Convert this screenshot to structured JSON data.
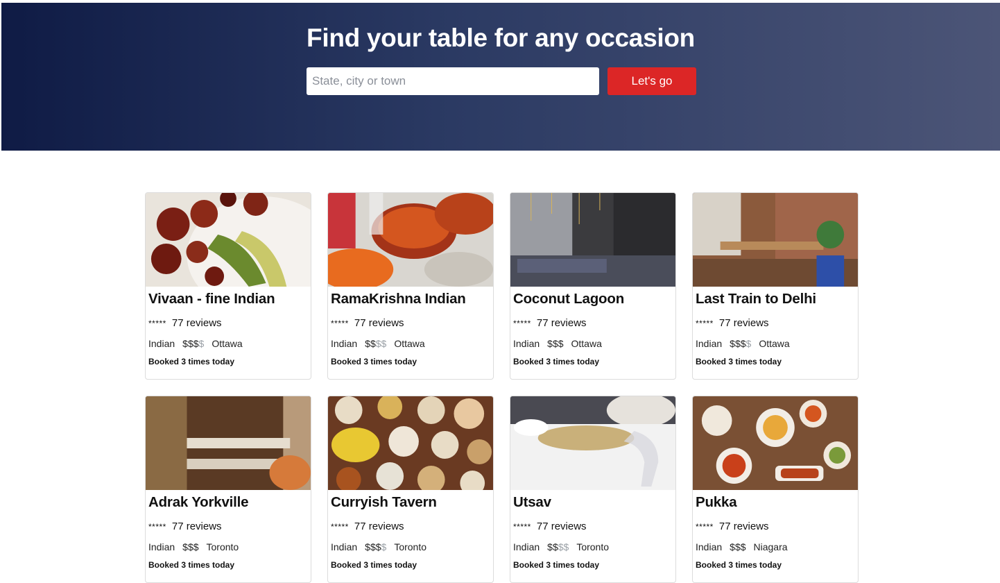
{
  "hero": {
    "title": "Find your table for any occasion",
    "search_placeholder": "State, city or town",
    "search_value": "",
    "button_label": "Let's go"
  },
  "colors": {
    "accent": "#dc2626",
    "hero_gradient_start": "#0f1b45",
    "hero_gradient_end": "#4c5577"
  },
  "restaurants": [
    {
      "name": "Vivaan - fine Indian",
      "stars": "*****",
      "reviews": "77 reviews",
      "cuisine": "Indian",
      "price_active": "$$$",
      "price_inactive": "$",
      "city": "Ottawa",
      "booked": "Booked 3 times today"
    },
    {
      "name": "RamaKrishna Indian",
      "stars": "*****",
      "reviews": "77 reviews",
      "cuisine": "Indian",
      "price_active": "$$",
      "price_inactive": "$$",
      "city": "Ottawa",
      "booked": "Booked 3 times today"
    },
    {
      "name": "Coconut Lagoon",
      "stars": "*****",
      "reviews": "77 reviews",
      "cuisine": "Indian",
      "price_active": "$$$",
      "price_inactive": "",
      "city": "Ottawa",
      "booked": "Booked 3 times today"
    },
    {
      "name": "Last Train to Delhi",
      "stars": "*****",
      "reviews": "77 reviews",
      "cuisine": "Indian",
      "price_active": "$$$",
      "price_inactive": "$",
      "city": "Ottawa",
      "booked": "Booked 3 times today"
    },
    {
      "name": "Adrak Yorkville",
      "stars": "*****",
      "reviews": "77 reviews",
      "cuisine": "Indian",
      "price_active": "$$$",
      "price_inactive": "",
      "city": "Toronto",
      "booked": "Booked 3 times today"
    },
    {
      "name": "Curryish Tavern",
      "stars": "*****",
      "reviews": "77 reviews",
      "cuisine": "Indian",
      "price_active": "$$$",
      "price_inactive": "$",
      "city": "Toronto",
      "booked": "Booked 3 times today"
    },
    {
      "name": "Utsav",
      "stars": "*****",
      "reviews": "77 reviews",
      "cuisine": "Indian",
      "price_active": "$$",
      "price_inactive": "$$",
      "city": "Toronto",
      "booked": "Booked 3 times today"
    },
    {
      "name": "Pukka",
      "stars": "*****",
      "reviews": "77 reviews",
      "cuisine": "Indian",
      "price_active": "$$$",
      "price_inactive": "",
      "city": "Niagara",
      "booked": "Booked 3 times today"
    }
  ]
}
